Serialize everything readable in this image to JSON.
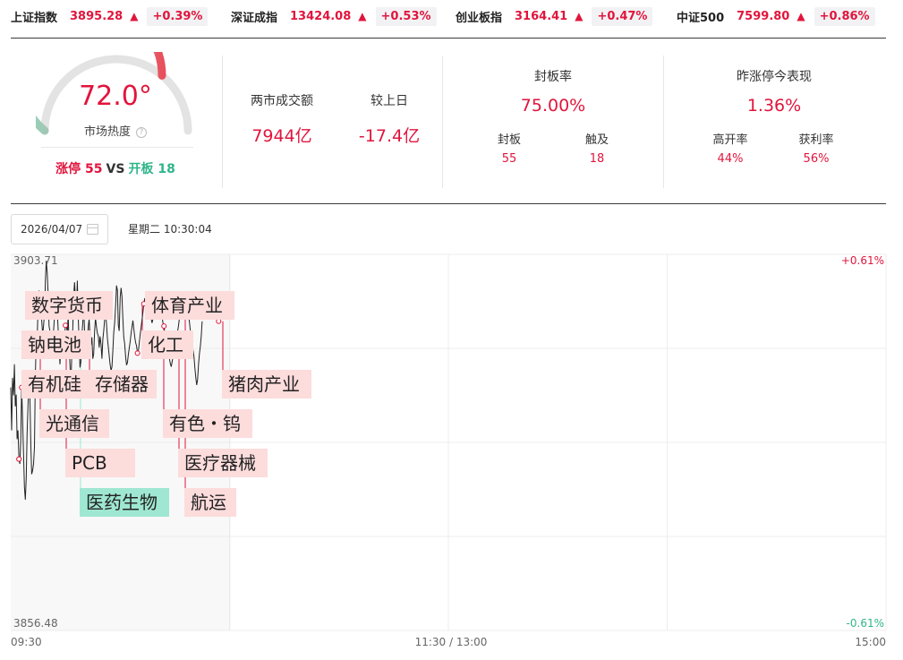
{
  "indices": [
    {
      "name": "上证指数",
      "price": "3895.28",
      "arrow": "▲",
      "change": "+0.39%"
    },
    {
      "name": "深证成指",
      "price": "13424.08",
      "arrow": "▲",
      "change": "+0.53%"
    },
    {
      "name": "创业板指",
      "price": "3164.41",
      "arrow": "▲",
      "change": "+0.47%"
    },
    {
      "name": "中证500",
      "price": "7599.80",
      "arrow": "▲",
      "change": "+0.86%"
    }
  ],
  "gauge": {
    "value": "72.0°",
    "level": 0.72,
    "label": "市场热度",
    "info_icon": "?",
    "limit_up_label": "涨停 55",
    "vs": "VS",
    "break_label": "开板 18"
  },
  "turnover": {
    "label": "两市成交额",
    "value": "7944亿",
    "compare_label": "较上日",
    "compare_value": "-17.4亿"
  },
  "seal": {
    "title": "封板率",
    "value": "75.00%",
    "items": [
      {
        "label": "封板",
        "value": "55"
      },
      {
        "label": "触及",
        "value": "18"
      }
    ]
  },
  "yesterday": {
    "title": "昨涨停今表现",
    "value": "1.36%",
    "items": [
      {
        "label": "高开率",
        "value": "44%"
      },
      {
        "label": "获利率",
        "value": "56%"
      }
    ]
  },
  "date": "2026/04/07",
  "weekday_time": "星期二 10:30:04",
  "chart_data": {
    "type": "line",
    "title": "",
    "ylim": [
      3856.48,
      3903.71
    ],
    "y_max_label": "3903.71",
    "y_min_label": "3856.48",
    "pct_max_label": "+0.61%",
    "pct_min_label": "-0.61%",
    "x_ticks": [
      "09:30",
      "11:30 / 13:00",
      "15:00"
    ],
    "grid": true,
    "series": [
      {
        "values": [
          3887.0,
          3881.6,
          3888.2,
          3886.0,
          3889.9,
          3884.6,
          3886.1,
          3880.5,
          3881.6,
          3878.0,
          3877.4,
          3880.4,
          3887.0,
          3883.1,
          3878.7,
          3874.5,
          3872.9,
          3875.6,
          3881.3,
          3885.0,
          3887.8,
          3885.9,
          3880.0,
          3876.1,
          3876.6,
          3877.4,
          3879.5,
          3888.3,
          3893.2,
          3892.9,
          3897.4,
          3899.1,
          3899.0,
          3898.1,
          3895.4,
          3893.6,
          3894.8,
          3896.2,
          3900.3,
          3902.9,
          3901.3,
          3898.7,
          3894.7,
          3894.1,
          3892.5,
          3891.0,
          3893.4,
          3894.2,
          3895.9,
          3897.0,
          3897.8,
          3896.6,
          3894.2,
          3892.0,
          3889.9,
          3892.4,
          3894.0,
          3893.6,
          3892.6,
          3893.2,
          3894.8,
          3895.0,
          3893.8,
          3896.1,
          3892.4,
          3889.8,
          3887.0,
          3891.6,
          3894.3,
          3898.4,
          3900.2,
          3898.2,
          3896.3,
          3900.4,
          3896.1,
          3892.4,
          3889.5,
          3890.2,
          3893.6,
          3895.1,
          3897.3,
          3894.0,
          3891.5,
          3891.9,
          3893.2,
          3894.6,
          3895.6,
          3893.5,
          3892.3,
          3893.3,
          3890.6,
          3891.2,
          3894.0,
          3895.7,
          3894.6,
          3893.8,
          3893.5,
          3892.0,
          3893.4,
          3892.4,
          3890.6,
          3893.0,
          3894.1,
          3895.5,
          3896.2,
          3895.0,
          3893.2,
          3892.1,
          3891.0,
          3889.9,
          3889.1,
          3889.6,
          3891.6,
          3893.9,
          3895.1,
          3897.3,
          3899.8,
          3899.2,
          3894.8,
          3894.1,
          3898.3,
          3899.5,
          3898.4,
          3895.6,
          3893.3,
          3892.5,
          3890.8,
          3889.8,
          3890.1,
          3891.1,
          3891.9,
          3892.8,
          3893.8,
          3894.6,
          3895.4,
          3894.4,
          3893.3,
          3892.6,
          3892.2,
          3891.3,
          3891.5,
          3892.6,
          3893.7,
          3894.6,
          3895.5,
          3896.4,
          3897.5,
          3898.2,
          3897.4,
          3896.7,
          3896.2,
          3895.8,
          3896.0,
          3896.2,
          3895.6,
          3895.1,
          3895.6,
          3896.0,
          3896.3,
          3896.7,
          3897.3,
          3897.8,
          3897.4,
          3897.0,
          3896.4,
          3896.8,
          3895.9,
          3895.1,
          3894.7,
          3893.8,
          3893.3,
          3892.6,
          3891.9,
          3891.4,
          3890.6,
          3890.0,
          3889.6,
          3890.2,
          3890.8,
          3891.3,
          3891.8,
          3892.4,
          3893.1,
          3894.0,
          3894.7,
          3895.7,
          3896.5,
          3897.4,
          3898.2,
          3898.8,
          3898.3,
          3898.0,
          3897.6,
          3897.4,
          3896.8,
          3895.9,
          3895.2,
          3894.1,
          3893.4,
          3892.3,
          3891.6,
          3890.8,
          3889.4,
          3888.2,
          3887.3,
          3888.0,
          3890.0,
          3891.3,
          3892.2,
          3893.5,
          3895.3
        ]
      }
    ],
    "annotations": [
      {
        "label": "数字货币",
        "minute": 12
      },
      {
        "label": "钠电池",
        "minute": 9
      },
      {
        "label": "有机硅",
        "minute": 9
      },
      {
        "label": "存储器",
        "minute": 60
      },
      {
        "label": "光通信",
        "minute": 28
      },
      {
        "label": "PCB",
        "minute": 59
      },
      {
        "label": "医药生物",
        "minute": 75
      },
      {
        "label": "体育产业",
        "minute": 139
      },
      {
        "label": "化工",
        "minute": 146
      },
      {
        "label": "猪肉产业",
        "minute": 228
      },
      {
        "label": "有色・钨",
        "minute": 168
      },
      {
        "label": "医疗器械",
        "minute": 181
      },
      {
        "label": "航运",
        "minute": 186
      }
    ]
  }
}
